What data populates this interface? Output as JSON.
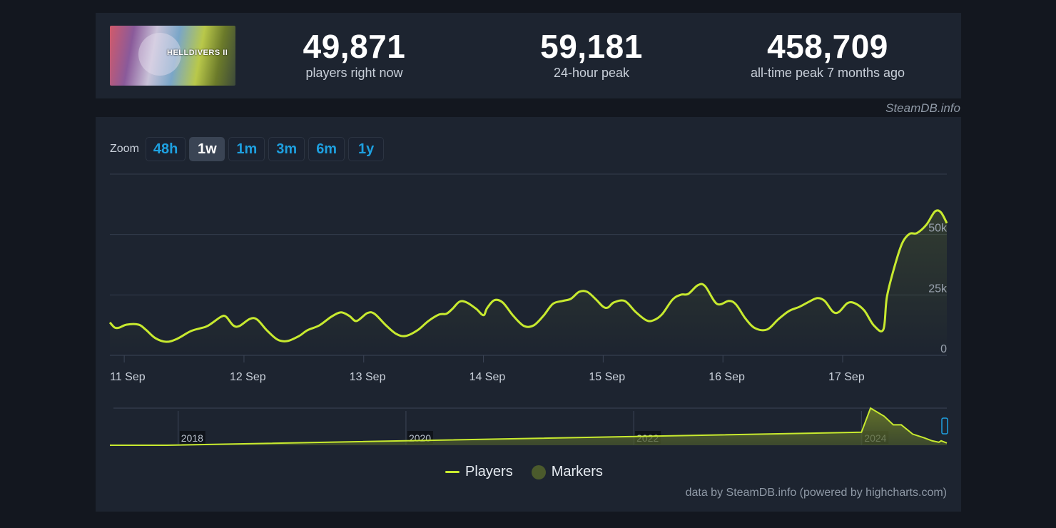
{
  "header": {
    "game_image_alt": "Helldivers II cover art",
    "game_logo_text": "HELLDIVERS II",
    "stats": [
      {
        "value": "49,871",
        "label": "players right now"
      },
      {
        "value": "59,181",
        "label": "24-hour peak"
      },
      {
        "value": "458,709",
        "label": "all-time peak 7 months ago"
      }
    ],
    "brand": "SteamDB.info"
  },
  "zoom": {
    "label": "Zoom",
    "options": [
      "48h",
      "1w",
      "1m",
      "3m",
      "6m",
      "1y"
    ],
    "active": "1w"
  },
  "legend": {
    "players": "Players",
    "markers": "Markers"
  },
  "credits": "data by SteamDB.info (powered by highcharts.com)",
  "colors": {
    "line": "#c8ea2f",
    "accent": "#1ea0e0",
    "markers": "#4b5a2c"
  },
  "chart_data": [
    {
      "type": "line",
      "title": "",
      "xlabel": "",
      "ylabel": "",
      "series_name": "Players",
      "x_unit": "days since 11 Sep 00:00",
      "x_ticks": [
        {
          "label": "11 Sep",
          "x": 0
        },
        {
          "label": "12 Sep",
          "x": 1
        },
        {
          "label": "13 Sep",
          "x": 2
        },
        {
          "label": "14 Sep",
          "x": 3
        },
        {
          "label": "15 Sep",
          "x": 4
        },
        {
          "label": "16 Sep",
          "x": 5
        },
        {
          "label": "17 Sep",
          "x": 6
        }
      ],
      "y_ticks": [
        {
          "label": "0",
          "y": 0
        },
        {
          "label": "25k",
          "y": 25000
        },
        {
          "label": "50k",
          "y": 50000
        }
      ],
      "xlim": [
        -0.12,
        6.87
      ],
      "ylim": [
        0,
        75000
      ],
      "grid": true,
      "points": [
        [
          -0.12,
          13600
        ],
        [
          -0.08,
          11500
        ],
        [
          -0.04,
          11500
        ],
        [
          0.02,
          12700
        ],
        [
          0.12,
          12700
        ],
        [
          0.18,
          10600
        ],
        [
          0.26,
          7100
        ],
        [
          0.35,
          5600
        ],
        [
          0.44,
          6800
        ],
        [
          0.56,
          10100
        ],
        [
          0.68,
          11800
        ],
        [
          0.74,
          13600
        ],
        [
          0.81,
          16000
        ],
        [
          0.85,
          16000
        ],
        [
          0.91,
          12400
        ],
        [
          0.96,
          12100
        ],
        [
          1.05,
          15100
        ],
        [
          1.11,
          14800
        ],
        [
          1.19,
          10400
        ],
        [
          1.28,
          6500
        ],
        [
          1.36,
          5900
        ],
        [
          1.46,
          8000
        ],
        [
          1.53,
          10400
        ],
        [
          1.63,
          12400
        ],
        [
          1.73,
          16000
        ],
        [
          1.81,
          17800
        ],
        [
          1.88,
          16300
        ],
        [
          1.94,
          14200
        ],
        [
          2.03,
          17500
        ],
        [
          2.09,
          17200
        ],
        [
          2.18,
          12700
        ],
        [
          2.27,
          8900
        ],
        [
          2.35,
          8000
        ],
        [
          2.45,
          10400
        ],
        [
          2.54,
          14200
        ],
        [
          2.63,
          16900
        ],
        [
          2.69,
          17200
        ],
        [
          2.74,
          19200
        ],
        [
          2.8,
          22200
        ],
        [
          2.86,
          21900
        ],
        [
          2.94,
          19200
        ],
        [
          3.0,
          16600
        ],
        [
          3.03,
          19500
        ],
        [
          3.09,
          22800
        ],
        [
          3.16,
          21900
        ],
        [
          3.25,
          16300
        ],
        [
          3.34,
          12100
        ],
        [
          3.42,
          12400
        ],
        [
          3.5,
          16300
        ],
        [
          3.58,
          21300
        ],
        [
          3.66,
          22500
        ],
        [
          3.73,
          23400
        ],
        [
          3.8,
          26300
        ],
        [
          3.866,
          26300
        ],
        [
          3.94,
          23100
        ],
        [
          4.0,
          20100
        ],
        [
          4.04,
          19800
        ],
        [
          4.09,
          21900
        ],
        [
          4.18,
          22500
        ],
        [
          4.27,
          18000
        ],
        [
          4.36,
          14500
        ],
        [
          4.42,
          14500
        ],
        [
          4.49,
          16900
        ],
        [
          4.58,
          23100
        ],
        [
          4.65,
          25100
        ],
        [
          4.71,
          25400
        ],
        [
          4.79,
          29000
        ],
        [
          4.85,
          28700
        ],
        [
          4.95,
          21300
        ],
        [
          5.05,
          22500
        ],
        [
          5.11,
          21000
        ],
        [
          5.19,
          15100
        ],
        [
          5.27,
          11200
        ],
        [
          5.37,
          10700
        ],
        [
          5.46,
          14800
        ],
        [
          5.55,
          18300
        ],
        [
          5.64,
          20100
        ],
        [
          5.72,
          22200
        ],
        [
          5.79,
          23700
        ],
        [
          5.85,
          22500
        ],
        [
          5.92,
          18000
        ],
        [
          5.97,
          18000
        ],
        [
          6.04,
          21600
        ],
        [
          6.1,
          21600
        ],
        [
          6.18,
          18600
        ],
        [
          6.26,
          12400
        ],
        [
          6.34,
          10700
        ],
        [
          6.37,
          24300
        ],
        [
          6.44,
          37900
        ],
        [
          6.5,
          46700
        ],
        [
          6.56,
          50300
        ],
        [
          6.62,
          50600
        ],
        [
          6.7,
          54100
        ],
        [
          6.77,
          59500
        ],
        [
          6.82,
          59200
        ],
        [
          6.87,
          54700
        ]
      ]
    },
    {
      "type": "area",
      "title": "navigator",
      "x_ticks": [
        "2018",
        "2020",
        "2022",
        "2024"
      ],
      "xlim": [
        2017.4,
        2024.75
      ],
      "series_name": "Players (overview)",
      "points": [
        [
          2017.4,
          0
        ],
        [
          2017.9,
          0
        ],
        [
          2024.0,
          0.35
        ],
        [
          2024.08,
          1.0
        ],
        [
          2024.2,
          0.78
        ],
        [
          2024.28,
          0.55
        ],
        [
          2024.35,
          0.55
        ],
        [
          2024.45,
          0.3
        ],
        [
          2024.55,
          0.2
        ],
        [
          2024.62,
          0.12
        ],
        [
          2024.68,
          0.08
        ],
        [
          2024.7,
          0.12
        ],
        [
          2024.75,
          0.06
        ]
      ],
      "y_unit": "fraction of all-time peak"
    }
  ]
}
